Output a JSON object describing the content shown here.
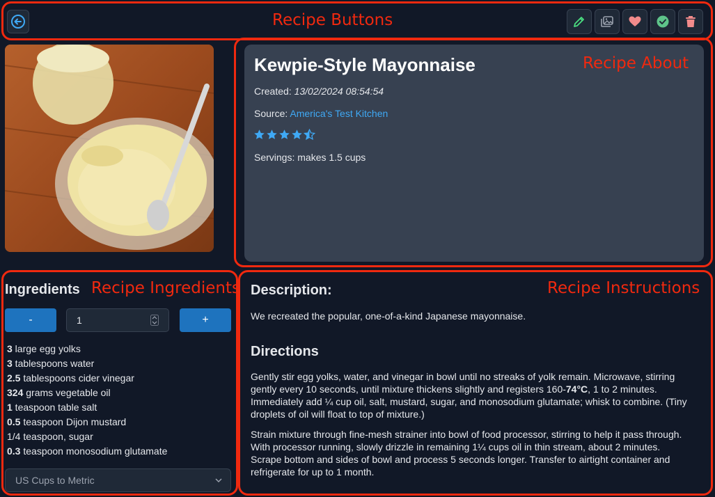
{
  "annotations": {
    "buttons": "Recipe Buttons",
    "about": "Recipe About",
    "ingredients": "Recipe Ingredients",
    "instructions": "Recipe Instructions"
  },
  "toolbar": {
    "icons": [
      "back-icon",
      "pencil-icon",
      "images-icon",
      "heart-icon",
      "check-icon",
      "trash-icon"
    ]
  },
  "about": {
    "title": "Kewpie-Style Mayonnaise",
    "created_label": "Created:",
    "created_value": "13/02/2024 08:54:54",
    "source_label": "Source:",
    "source_value": "America's Test Kitchen",
    "rating": 4.5,
    "servings_text": "Servings: makes 1.5 cups"
  },
  "ingredients": {
    "title": "Ingredients",
    "minus_label": "-",
    "plus_label": "+",
    "servings_value": "1",
    "items": [
      {
        "qty": "3",
        "text": " large egg yolks"
      },
      {
        "qty": "3",
        "text": " tablespoons water"
      },
      {
        "qty": "2.5",
        "text": " tablespoons cider vinegar"
      },
      {
        "qty": "324",
        "text": " grams vegetable oil"
      },
      {
        "qty": "1",
        "text": " teaspoon table salt"
      },
      {
        "qty": "0.5",
        "text": " teaspoon Dijon mustard"
      },
      {
        "qty": "",
        "text": "1/4 teaspoon, sugar"
      },
      {
        "qty": "0.3",
        "text": " teaspoon monosodium glutamate"
      }
    ],
    "conversion_select": "US Cups to Metric"
  },
  "instructions": {
    "description_title": "Description:",
    "description": "We recreated the popular, one-of-a-kind Japanese mayonnaise.",
    "directions_title": "Directions",
    "step1_a": "Gently stir egg yolks, water, and vinegar in bowl until no streaks of yolk remain. Microwave, stirring gently every 10 seconds, until mixture thickens slightly and registers 160-",
    "step1_temp": "74°C",
    "step1_b": ", 1 to 2 minutes. Immediately add ¼ cup oil, salt, mustard, sugar, and monosodium glutamate; whisk to combine. (Tiny droplets of oil will float to top of mixture.)",
    "step2": "Strain mixture through fine-mesh strainer into bowl of food processor, stirring to help it pass through. With processor running, slowly drizzle in remaining 1¼ cups oil in thin stream, about 2 minutes. Scrape bottom and sides of bowl and process 5 seconds longer. Transfer to airtight container and refrigerate for up to 1 month."
  },
  "colors": {
    "background": "#111827",
    "card": "#374151",
    "accent_blue": "#1e73be",
    "link": "#3fa9f5",
    "annotation": "#f0290f"
  }
}
